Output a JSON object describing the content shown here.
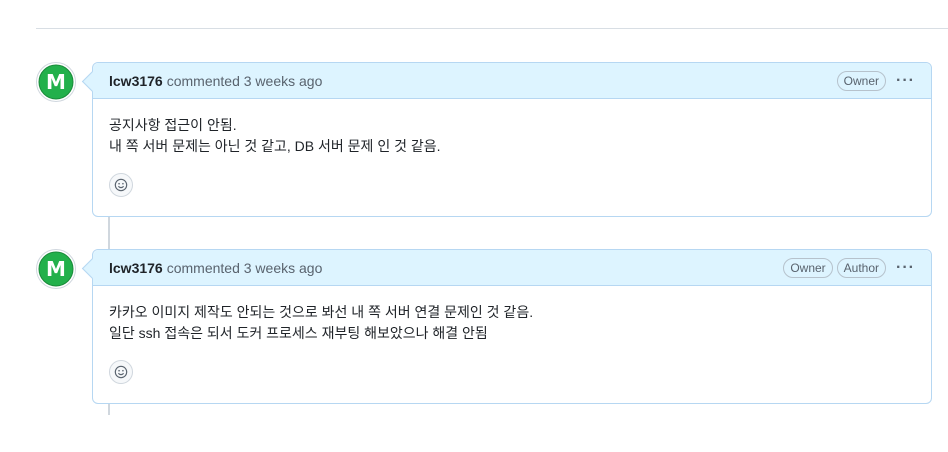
{
  "comments": [
    {
      "author": "lcw3176",
      "meta": "commented 3 weeks ago",
      "badges": [
        "Owner"
      ],
      "lines": [
        "공지사항 접근이 안됨.",
        "내 쪽 서버 문제는 아닌 것 같고, DB 서버 문제 인 것 같음."
      ],
      "avatar_letter": "M",
      "icons": {
        "avatar": "green-m-avatar",
        "menu": "kebab-icon",
        "reaction": "smiley-icon"
      }
    },
    {
      "author": "lcw3176",
      "meta": "commented 3 weeks ago",
      "badges": [
        "Owner",
        "Author"
      ],
      "lines": [
        "카카오 이미지 제작도 안되는 것으로 봐선 내 쪽 서버 연결 문제인 것 같음.",
        "일단 ssh 접속은 되서 도커 프로세스 재부팅 해보았으나 해결 안됨"
      ],
      "avatar_letter": "M",
      "icons": {
        "avatar": "green-m-avatar",
        "menu": "kebab-icon",
        "reaction": "smiley-icon"
      }
    }
  ],
  "colors": {
    "header_bg": "#ddf4ff",
    "border": "#b6d7f2",
    "avatar_green": "#22b04b"
  },
  "kebab_glyph": "···"
}
